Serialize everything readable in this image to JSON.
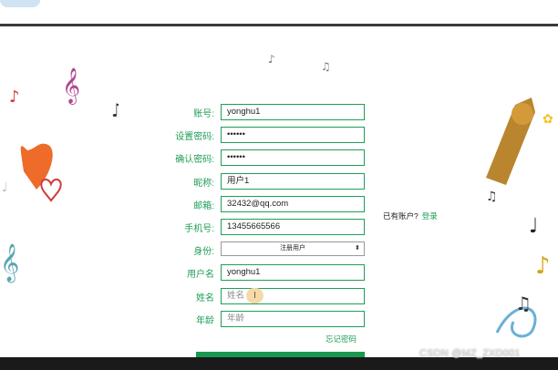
{
  "form": {
    "fields": [
      {
        "label": "账号:",
        "value": "yonghu1"
      },
      {
        "label": "设置密码:",
        "value": "••••••"
      },
      {
        "label": "确认密码:",
        "value": "••••••"
      },
      {
        "label": "昵称:",
        "value": "用户1"
      },
      {
        "label": "邮箱:",
        "value": "32432@qq.com"
      },
      {
        "label": "手机号:",
        "value": "13455665566"
      },
      {
        "label": "身份:",
        "value": "注册用户"
      },
      {
        "label": "用户名",
        "value": "yonghu1"
      },
      {
        "label": "姓名",
        "placeholder": "姓名"
      },
      {
        "label": "年龄",
        "placeholder": "年龄"
      }
    ],
    "forgot_password": "忘记密码"
  },
  "aside": {
    "question": "已有账户?",
    "login_link": "登录"
  },
  "watermark": "CSDN @MZ_ZXD001",
  "colors": {
    "accent": "#1e9e57",
    "topline": "#3a3a3a"
  }
}
